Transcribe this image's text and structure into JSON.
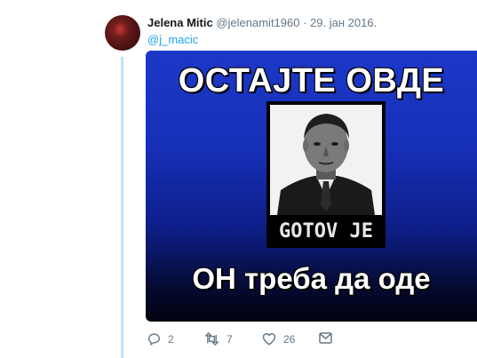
{
  "tweet": {
    "author_name": "Jelena Mitic",
    "handle": "@jelenamit1960",
    "separator": "·",
    "date": "29. јан 2016.",
    "reply_to": "@j_macic"
  },
  "media": {
    "headline_top": "ОСТАЈТЕ ОВДЕ",
    "stamp_text": "GOTOV JE",
    "headline_bottom": "ОН треба да оде"
  },
  "actions": {
    "reply_count": "2",
    "retweet_count": "7",
    "like_count": "26"
  },
  "colors": {
    "accent": "#1da1f2",
    "muted": "#657786",
    "thread_line": "#bfe2f6",
    "banner_blue": "#1d38c8"
  },
  "icons": [
    "reply-icon",
    "retweet-icon",
    "like-icon",
    "message-icon"
  ]
}
